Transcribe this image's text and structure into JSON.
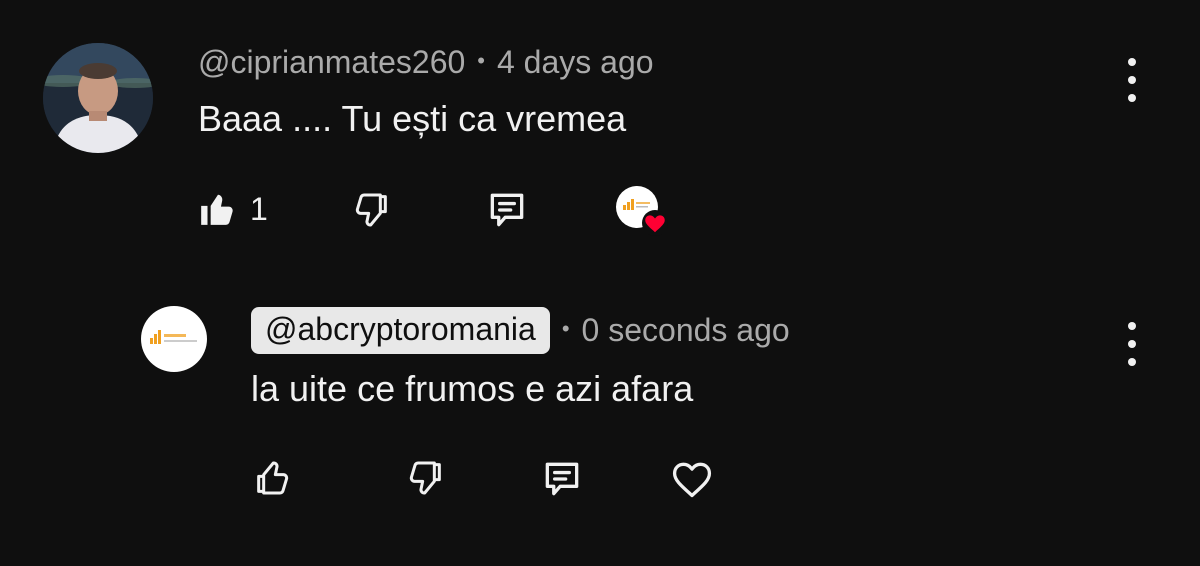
{
  "comment": {
    "author": "@ciprianmates260",
    "separator": "•",
    "time": "4 days ago",
    "text": "Baaa .... Tu ești ca vremea",
    "like_count": "1",
    "icons": {
      "like": "thumbs-up-filled-icon",
      "dislike": "thumbs-down-icon",
      "reply": "comment-bubble-icon",
      "creator_heart": "creator-heart-badge",
      "menu": "more-vertical-icon"
    }
  },
  "reply": {
    "author": "@abcryptoromania",
    "separator": "•",
    "time": "0 seconds ago",
    "text": "la uite ce frumos e azi afara",
    "icons": {
      "like": "thumbs-up-outline-icon",
      "dislike": "thumbs-down-icon",
      "reply": "comment-bubble-icon",
      "heart": "heart-outline-icon",
      "menu": "more-vertical-icon"
    }
  },
  "colors": {
    "background": "#0f0f0f",
    "primary_text": "#f1f1f1",
    "secondary_text": "#aaaaaa",
    "handle_chip": "#e8e8e8",
    "heart_red": "#ff0033",
    "logo_orange": "#f0a020"
  }
}
